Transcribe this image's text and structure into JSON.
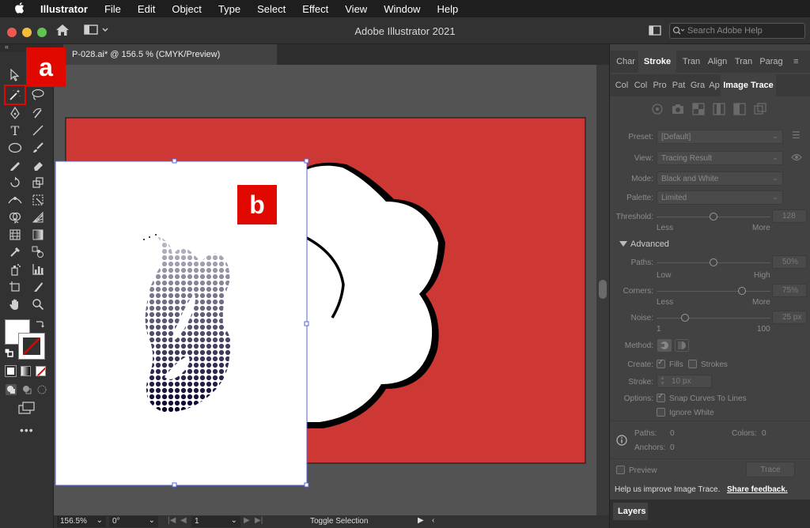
{
  "menubar": {
    "items": [
      "Illustrator",
      "File",
      "Edit",
      "Object",
      "Type",
      "Select",
      "Effect",
      "View",
      "Window",
      "Help"
    ]
  },
  "app": {
    "title": "Adobe Illustrator 2021",
    "search_placeholder": "Search Adobe Help"
  },
  "document": {
    "tab_label": "P-028.ai* @ 156.5 % (CMYK/Preview)"
  },
  "callouts": {
    "a": "a",
    "b": "b"
  },
  "status": {
    "zoom": "156.5%",
    "rotation": "0°",
    "artboard": "1",
    "mode": "Toggle Selection"
  },
  "panel": {
    "tabs_row1": [
      "Char",
      "Stroke",
      "Tran",
      "Align",
      "Tran",
      "Parag"
    ],
    "tabs_row2": [
      "Col",
      "Col",
      "Pro",
      "Pat",
      "Gra",
      "Ap",
      "Image Trace"
    ],
    "preset_label": "Preset:",
    "preset_value": "[Default]",
    "view_label": "View:",
    "view_value": "Tracing Result",
    "mode_label": "Mode:",
    "mode_value": "Black and White",
    "palette_label": "Palette:",
    "palette_value": "Limited",
    "threshold_label": "Threshold:",
    "threshold_value": "128",
    "threshold_fraction": 0.5,
    "less": "Less",
    "more": "More",
    "advanced_label": "Advanced",
    "paths_label": "Paths:",
    "paths_value": "50%",
    "paths_fraction": 0.5,
    "low": "Low",
    "high": "High",
    "corners_label": "Corners:",
    "corners_value": "75%",
    "corners_fraction": 0.75,
    "noise_label": "Noise:",
    "noise_value": "25 px",
    "noise_min": "1",
    "noise_max": "100",
    "method_label": "Method:",
    "create_label": "Create:",
    "fills_label": "Fills",
    "strokes_label": "Strokes",
    "stroke_label": "Stroke:",
    "stroke_value": "10 px",
    "options_label": "Options:",
    "snap_label": "Snap Curves To Lines",
    "ignore_white_label": "Ignore White",
    "stat_paths_label": "Paths:",
    "stat_paths_value": "0",
    "stat_colors_label": "Colors:",
    "stat_colors_value": "0",
    "stat_anchors_label": "Anchors:",
    "stat_anchors_value": "0",
    "preview_label": "Preview",
    "trace_button": "Trace",
    "feedback_text": "Help us improve Image Trace.",
    "feedback_link": "Share feedback.",
    "layers_tab": "Layers"
  },
  "colors": {
    "artboard_red": "#cd3734",
    "highlight_red": "#e10800",
    "selection_blue": "#5566dd"
  },
  "icons": [
    "apple-icon",
    "home-icon",
    "workspace-switcher-icon",
    "search-icon",
    "selection-tool-icon",
    "magic-wand-tool-icon",
    "info-icon"
  ]
}
